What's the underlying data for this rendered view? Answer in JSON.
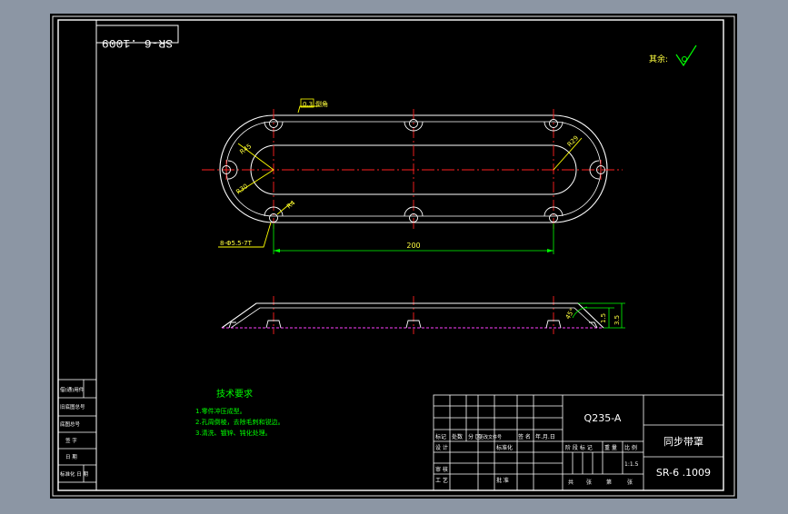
{
  "colors": {
    "background_outer": "#8c96a4",
    "sheet": "#000000",
    "frame": "#ffffff",
    "center_line": "#ff2020",
    "dimension": "#00ff00",
    "leader": "#ffff00",
    "annotation_text": "#ffff40",
    "notes_text": "#00ff00",
    "hidden_line": "#ff40ff"
  },
  "drawing": {
    "top_code_mirrored": "SR-6 .1009",
    "roughness_label": "其余:",
    "top_view": {
      "dim_length": "200",
      "dim_r_left_top": "R45",
      "dim_r_left_inner": "R30",
      "dim_r_right": "R29",
      "dim_hole_small": "R4",
      "hole_callout": "8-Φ5.5-7T",
      "finish_callout": "0.3",
      "finish_note": "倒角"
    },
    "side_view": {
      "dim_angle": "45°",
      "dim_height_inner": "1.5",
      "dim_height_outer": "3.5"
    },
    "notes": {
      "title": "技术要求",
      "items": [
        "1.零件冲压成型。",
        "2.孔周倒棱，去除毛刺和锐边。",
        "3.清洗、镀锌、钝化处理。"
      ]
    }
  },
  "left_strip": {
    "cells": [
      "借(通)用件",
      "旧底图总号",
      "底图总号",
      "签 字",
      "日 期",
      "标准化  日 期"
    ]
  },
  "title_block": {
    "material": "Q235-A",
    "part_name": "同步带罩",
    "drawing_number": "SR-6 .1009",
    "scale": "1:1.5",
    "rev_headers": [
      "标记",
      "处数",
      "分 区",
      "更改文件号",
      "签 名",
      "年.月.日"
    ],
    "row_design": [
      "设 计",
      "标准化"
    ],
    "row_audit": [
      "审 核"
    ],
    "row_process": [
      "工 艺",
      "批 准"
    ],
    "stage_headers": [
      "阶 段 标 记",
      "重 量",
      "比 例"
    ],
    "sheet_info": [
      "共",
      "张",
      "第",
      "张"
    ]
  }
}
